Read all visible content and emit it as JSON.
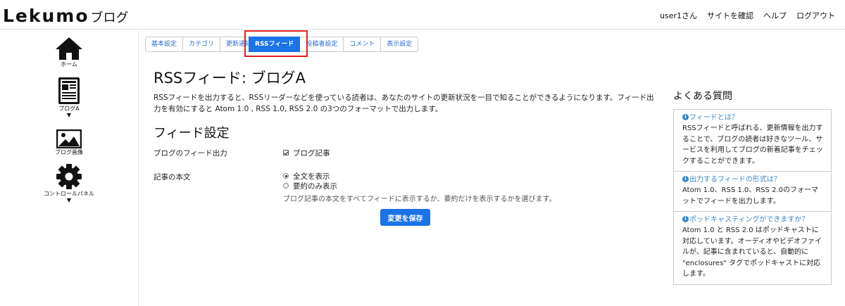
{
  "header": {
    "logo_main": "Lekumo",
    "logo_sub": "ブログ",
    "nav": [
      "user1さん",
      "サイトを確認",
      "ヘルプ",
      "ログアウト"
    ]
  },
  "sidebar": {
    "items": [
      {
        "label": "ホーム",
        "icon": "home-icon"
      },
      {
        "label": "ブログA",
        "icon": "blog-icon",
        "caret": "▼"
      },
      {
        "label": "ブログ画像",
        "icon": "image-icon"
      },
      {
        "label": "コントロールパネル",
        "icon": "gear-icon",
        "caret": "▼"
      }
    ]
  },
  "tabs": [
    "基本設定",
    "カテゴリ",
    "更新通知",
    "RSSフィード",
    "投稿者設定",
    "コメント",
    "表示設定"
  ],
  "active_tab": "RSSフィード",
  "main": {
    "title": "RSSフィード: ブログA",
    "description": "RSSフィードを出力すると、RSSリーダーなどを使っている読者は、あなたのサイトの更新状況を一目で知ることができるようになります。フィード出力を有効にすると Atom 1.0 , RSS 1.0, RSS 2.0 の3つのフォーマットで出力します。",
    "section_title": "フィード設定",
    "feed_output": {
      "label": "ブログのフィード出力",
      "checkbox_label": "ブログ記事",
      "checked": true
    },
    "body_setting": {
      "label": "記事の本文",
      "options": [
        "全文を表示",
        "要約のみ表示"
      ],
      "selected": "全文を表示",
      "help": "ブログ記事の本文をすべてフィードに表示するか、要約だけを表示するかを選びます。"
    },
    "save_label": "変更を保存"
  },
  "faq": {
    "title": "よくある質問",
    "items": [
      {
        "q": "フィードとは？",
        "a": "RSSフィードと呼ばれる、更新情報を出力することで、ブログの読者は好きなツール、サービスを利用してブログの新着記事をチェックすることができます。"
      },
      {
        "q": "出力するフィードの形式は？",
        "a": "Atom 1.0、RSS 1.0、RSS 2.0のフォーマットでフィードを出力します。"
      },
      {
        "q": "ポッドキャスティングができますか？",
        "a": "Atom 1.0 と RSS 2.0 はポッドキャストに対応しています。オーディオやビデオファイルが、記事に含まれていると、自動的に \"enclosures\" タグでポッドキャストに対応します。"
      }
    ]
  },
  "colors": {
    "accent": "#1a73e8",
    "link": "#3a86c9",
    "highlight_border": "#e02020"
  }
}
